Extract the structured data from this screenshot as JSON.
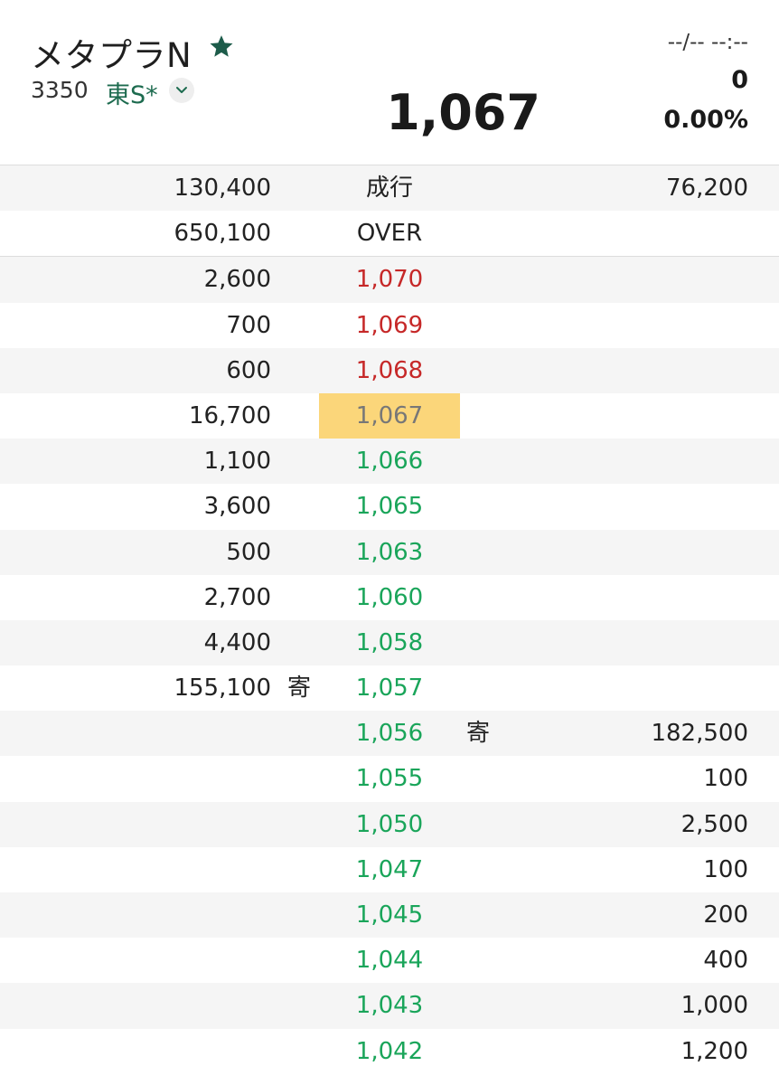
{
  "header": {
    "stock_name": "メタプラN",
    "code": "3350",
    "market": "東S*",
    "price": "1,067",
    "datetime": "--/-- --:--",
    "change": "0",
    "change_pct": "0.00%",
    "accent_color": "#1d6b4f"
  },
  "board": {
    "rows": [
      {
        "sell_qty": "130,400",
        "sell_mark": "",
        "price": "成行",
        "buy_mark": "",
        "buy_qty": "76,200",
        "tone": "neutral"
      },
      {
        "sell_qty": "650,100",
        "sell_mark": "",
        "price": "OVER",
        "buy_mark": "",
        "buy_qty": "",
        "tone": "neutral"
      },
      {
        "sell_qty": "2,600",
        "sell_mark": "",
        "price": "1,070",
        "buy_mark": "",
        "buy_qty": "",
        "tone": "up"
      },
      {
        "sell_qty": "700",
        "sell_mark": "",
        "price": "1,069",
        "buy_mark": "",
        "buy_qty": "",
        "tone": "up"
      },
      {
        "sell_qty": "600",
        "sell_mark": "",
        "price": "1,068",
        "buy_mark": "",
        "buy_qty": "",
        "tone": "up"
      },
      {
        "sell_qty": "16,700",
        "sell_mark": "",
        "price": "1,067",
        "buy_mark": "",
        "buy_qty": "",
        "tone": "current"
      },
      {
        "sell_qty": "1,100",
        "sell_mark": "",
        "price": "1,066",
        "buy_mark": "",
        "buy_qty": "",
        "tone": "down"
      },
      {
        "sell_qty": "3,600",
        "sell_mark": "",
        "price": "1,065",
        "buy_mark": "",
        "buy_qty": "",
        "tone": "down"
      },
      {
        "sell_qty": "500",
        "sell_mark": "",
        "price": "1,063",
        "buy_mark": "",
        "buy_qty": "",
        "tone": "down"
      },
      {
        "sell_qty": "2,700",
        "sell_mark": "",
        "price": "1,060",
        "buy_mark": "",
        "buy_qty": "",
        "tone": "down"
      },
      {
        "sell_qty": "4,400",
        "sell_mark": "",
        "price": "1,058",
        "buy_mark": "",
        "buy_qty": "",
        "tone": "down"
      },
      {
        "sell_qty": "155,100",
        "sell_mark": "寄",
        "price": "1,057",
        "buy_mark": "",
        "buy_qty": "",
        "tone": "down"
      },
      {
        "sell_qty": "",
        "sell_mark": "",
        "price": "1,056",
        "buy_mark": "寄",
        "buy_qty": "182,500",
        "tone": "down"
      },
      {
        "sell_qty": "",
        "sell_mark": "",
        "price": "1,055",
        "buy_mark": "",
        "buy_qty": "100",
        "tone": "down"
      },
      {
        "sell_qty": "",
        "sell_mark": "",
        "price": "1,050",
        "buy_mark": "",
        "buy_qty": "2,500",
        "tone": "down"
      },
      {
        "sell_qty": "",
        "sell_mark": "",
        "price": "1,047",
        "buy_mark": "",
        "buy_qty": "100",
        "tone": "down"
      },
      {
        "sell_qty": "",
        "sell_mark": "",
        "price": "1,045",
        "buy_mark": "",
        "buy_qty": "200",
        "tone": "down"
      },
      {
        "sell_qty": "",
        "sell_mark": "",
        "price": "1,044",
        "buy_mark": "",
        "buy_qty": "400",
        "tone": "down"
      },
      {
        "sell_qty": "",
        "sell_mark": "",
        "price": "1,043",
        "buy_mark": "",
        "buy_qty": "1,000",
        "tone": "down"
      },
      {
        "sell_qty": "",
        "sell_mark": "",
        "price": "1,042",
        "buy_mark": "",
        "buy_qty": "1,200",
        "tone": "down"
      }
    ]
  }
}
